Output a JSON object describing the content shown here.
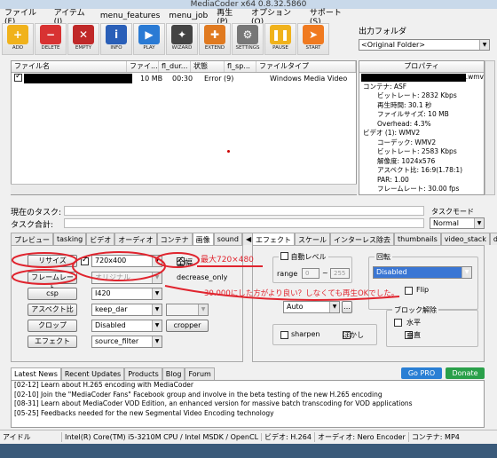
{
  "window": {
    "title": "MediaCoder x64 0.8.32.5860"
  },
  "menu": [
    "ファイル(F)",
    "アイテム(I)",
    "menu_features",
    "menu_job",
    "再生(P)",
    "オプション(O)",
    "サポート(S)"
  ],
  "toolbar": [
    {
      "label": "ADD",
      "icon": "add-icon",
      "color": "#f0b21c",
      "glyph": "+"
    },
    {
      "label": "DELETE",
      "icon": "delete-icon",
      "color": "#d83232",
      "glyph": "−"
    },
    {
      "label": "EMPTY",
      "icon": "empty-icon",
      "color": "#c02828",
      "glyph": "✕"
    },
    {
      "label": "INFO",
      "icon": "info-icon",
      "color": "#2a5fb8",
      "glyph": "i"
    },
    {
      "label": "PLAY",
      "icon": "play-icon",
      "color": "#2a7ad4",
      "glyph": "▶"
    },
    {
      "label": "WIZARD",
      "icon": "wizard-icon",
      "color": "#444444",
      "glyph": "✦"
    },
    {
      "label": "EXTEND",
      "icon": "extend-icon",
      "color": "#e07a20",
      "glyph": "✚"
    },
    {
      "label": "SETTINGS",
      "icon": "settings-icon",
      "color": "#777777",
      "glyph": "⚙"
    },
    {
      "label": "PAUSE",
      "icon": "pause-icon",
      "color": "#f0b21c",
      "glyph": "❚❚"
    },
    {
      "label": "START",
      "icon": "start-icon",
      "color": "#f07a20",
      "glyph": "➤"
    }
  ],
  "output": {
    "label": "出力フォルダ",
    "value": "<Original Folder>"
  },
  "filelist": {
    "columns": [
      "ファイル名",
      "ファイ...",
      "fl_dur...",
      "状態",
      "fl_sp...",
      "ファイルタイプ"
    ],
    "row": {
      "size": "10 MB",
      "duration": "00:30",
      "status": "Error (9)",
      "type": "Windows Media Video"
    }
  },
  "properties": {
    "title": "プロパティ",
    "file": ".wmv",
    "lines": [
      "コンテナ: ASF",
      "ビットレート: 2832 Kbps",
      "再生時間: 30.1 秒",
      "ファイルサイズ: 10 MB",
      "Overhead: 4.3%",
      "ビデオ (1): WMV2",
      "コーデック: WMV2",
      "ビットレート: 2583 Kbps",
      "解像度: 1024x576",
      "アスペクト比: 16:9(1.78:1)",
      "PAR: 1.00",
      "フレームレート: 30.00 fps"
    ]
  },
  "tasks": {
    "current": "現在のタスク:",
    "queue": "タスク合計:",
    "mode_label": "タスクモード",
    "mode_value": "Normal"
  },
  "left_tabs": [
    "プレビュー",
    "tasking",
    "ビデオ",
    "オーディオ",
    "コンテナ",
    "画像",
    "sound"
  ],
  "right_tabs": [
    "エフェクト",
    "スケール",
    "インターレス除去",
    "thumbnails",
    "video_stack",
    "delogo"
  ],
  "picture": {
    "resize": "リサイズ",
    "resize_value": "720x400",
    "lock": "全幅",
    "framerate": "フレームレート",
    "framerate_value": "オリジナル",
    "decrease_only": "decrease_only",
    "csp": "csp",
    "csp_value": "I420",
    "aspect": "アスペクト比",
    "aspect_value": "keep_dar",
    "crop": "クロップ",
    "crop_value": "Disabled",
    "cropper": "cropper",
    "effect": "エフェクト",
    "effect_value": "source_filter"
  },
  "effects": {
    "auto_level": "自動レベル",
    "range": "range",
    "range_from": "0",
    "range_to": "255",
    "rotate": "回転",
    "rotate_value": "Disabled",
    "flip": "Flip",
    "auto": "Auto",
    "deblock": "ブロック解除",
    "horizontal": "水平",
    "vertical": "垂直",
    "sharpen": "sharpen",
    "blur": "ぼかし"
  },
  "annotations": {
    "max": "最大720×480",
    "note": "30.000にした方がより良い？しなくても再生OKでした。"
  },
  "news": {
    "tabs": [
      "Latest News",
      "Recent Updates",
      "Products",
      "Blog",
      "Forum"
    ],
    "items": [
      "[02-12] Learn about H.265 encoding with MediaCoder",
      "[02-10] Join the \"MediaCoder Fans\" Facebook group and involve in the beta testing of the new H.265 encoding",
      "[08-31] Learn about MediaCoder VOD Edition, an enhanced version for massive batch transcoding for VOD applications",
      "[05-25] Feedbacks needed for the new Segmental Video Encoding technology"
    ],
    "gopro": "Go PRO",
    "donate": "Donate"
  },
  "status": [
    "アイドル",
    "Intel(R) Core(TM) i5-3210M CPU / Intel MSDK / OpenCL",
    "ビデオ: H.264",
    "オーディオ: Nero Encoder",
    "コンテナ: MP4"
  ],
  "colors": {
    "annotation": "#e0242e",
    "accent": "#2a7fd4"
  }
}
